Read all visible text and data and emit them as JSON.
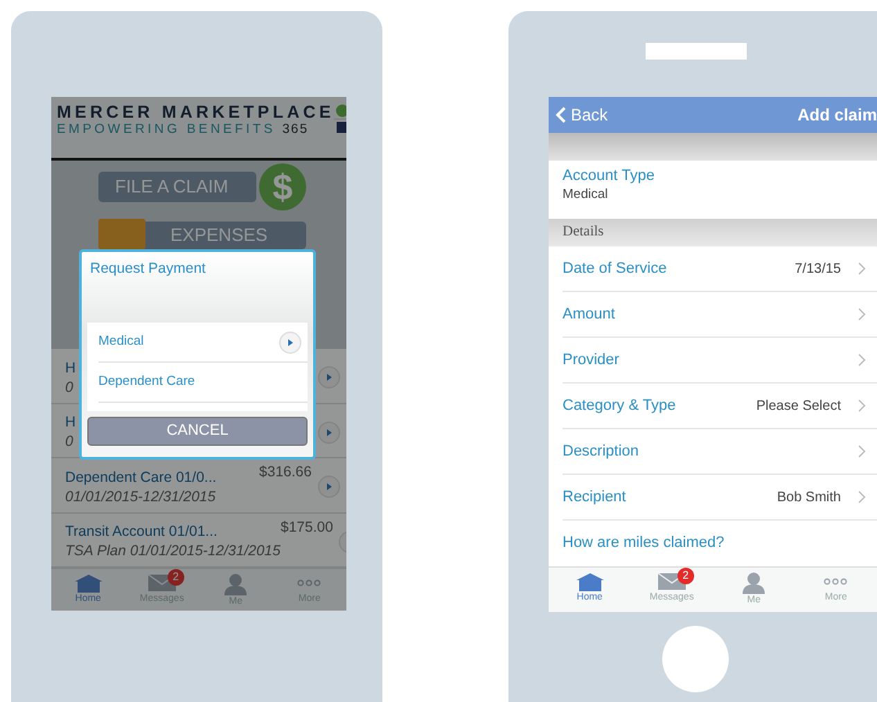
{
  "left_phone": {
    "header": {
      "brand": "MERCER MARKETPLACE",
      "tagline": "EMPOWERING BENEFITS",
      "tagline_number": "365"
    },
    "buttons": [
      {
        "kind": "claim",
        "label": "FILE A CLAIM",
        "icon_text": "$"
      },
      {
        "kind": "expenses",
        "label": "EXPENSES"
      }
    ],
    "accounts": [
      {
        "title": "H",
        "subtitle": "0"
      },
      {
        "title": "H",
        "subtitle": "0"
      },
      {
        "title": "Dependent Care 01/0...",
        "amount": "$316.66",
        "subtitle": "01/01/2015-12/31/2015"
      },
      {
        "title": "Transit Account 01/01...",
        "amount": "$175.00",
        "subtitle": "TSA Plan 01/01/2015-12/31/2015"
      }
    ],
    "tab_bar": [
      {
        "kind": "home",
        "label": "Home",
        "selected": true
      },
      {
        "kind": "messages",
        "label": "Messages",
        "selected": false,
        "badge": "2"
      },
      {
        "kind": "me",
        "label": "Me",
        "selected": false
      },
      {
        "kind": "more",
        "label": "More",
        "selected": false
      }
    ],
    "dialog": {
      "title": "Request Payment",
      "options": [
        {
          "label": "Medical",
          "arrow": true
        },
        {
          "label": "Dependent Care",
          "arrow": false
        }
      ],
      "cancel": "CANCEL"
    }
  },
  "right_phone": {
    "nav": {
      "back": "Back",
      "title": "Add claim"
    },
    "account_type": {
      "label": "Account Type",
      "value": "Medical"
    },
    "section": "Details",
    "rows": [
      {
        "label": "Date of Service",
        "value": "7/13/15"
      },
      {
        "label": "Amount"
      },
      {
        "label": "Provider"
      },
      {
        "label": "Category & Type",
        "value": "Please Select"
      },
      {
        "label": "Description"
      },
      {
        "label": "Recipient",
        "value": "Bob Smith"
      }
    ],
    "link": "How are miles claimed?",
    "tab_bar": [
      {
        "kind": "home",
        "label": "Home",
        "selected": true
      },
      {
        "kind": "messages",
        "label": "Messages",
        "selected": false,
        "badge": "2"
      },
      {
        "kind": "me",
        "label": "Me",
        "selected": false
      },
      {
        "kind": "more",
        "label": "More",
        "selected": false
      }
    ]
  }
}
